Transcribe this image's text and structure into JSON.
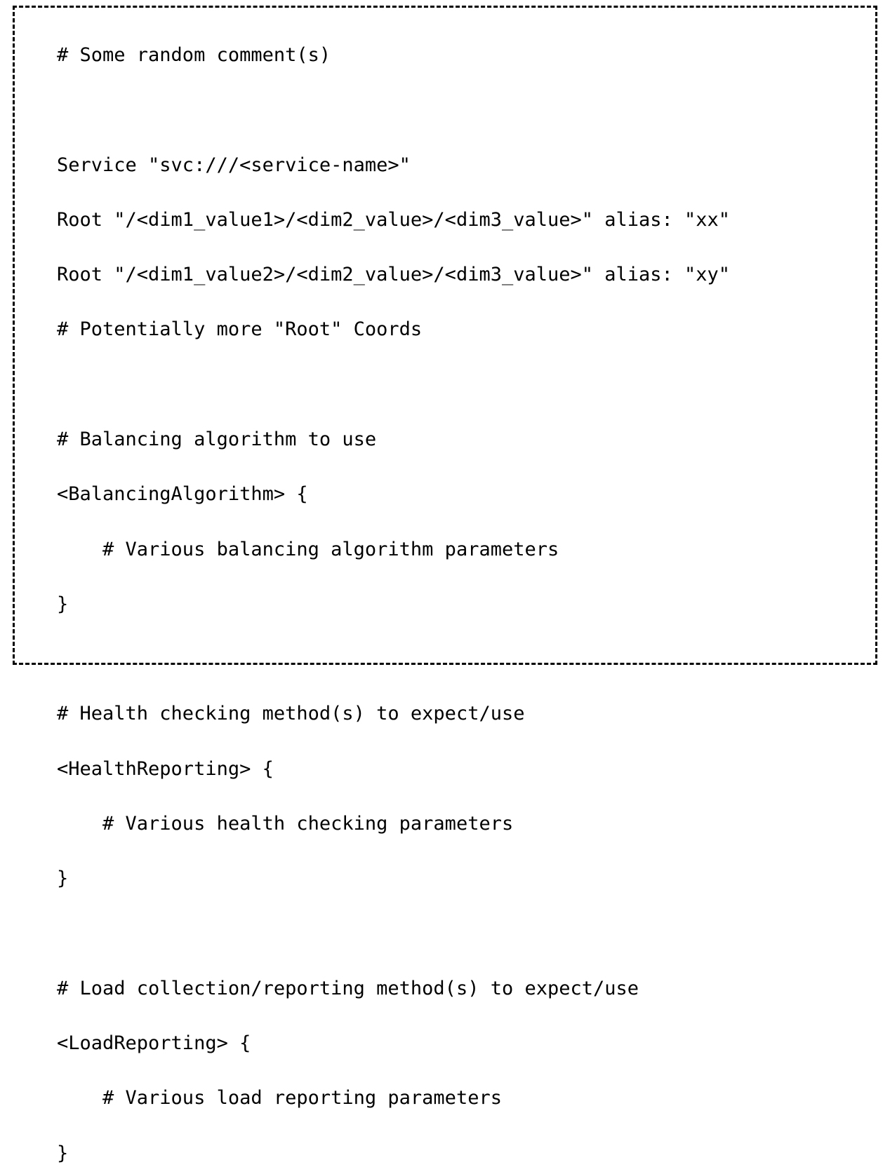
{
  "code": {
    "lines": [
      "# Some random comment(s)",
      "",
      "Service \"svc:///<service-name>\"",
      "Root \"/<dim1_value1>/<dim2_value>/<dim3_value>\" alias: \"xx\"",
      "Root \"/<dim1_value2>/<dim2_value>/<dim3_value>\" alias: \"xy\"",
      "# Potentially more \"Root\" Coords",
      "",
      "# Balancing algorithm to use",
      "<BalancingAlgorithm> {",
      "    # Various balancing algorithm parameters",
      "}",
      "",
      "# Health checking method(s) to expect/use",
      "<HealthReporting> {",
      "    # Various health checking parameters",
      "}",
      "",
      "# Load collection/reporting method(s) to expect/use",
      "<LoadReporting> {",
      "    # Various load reporting parameters",
      "}"
    ]
  }
}
